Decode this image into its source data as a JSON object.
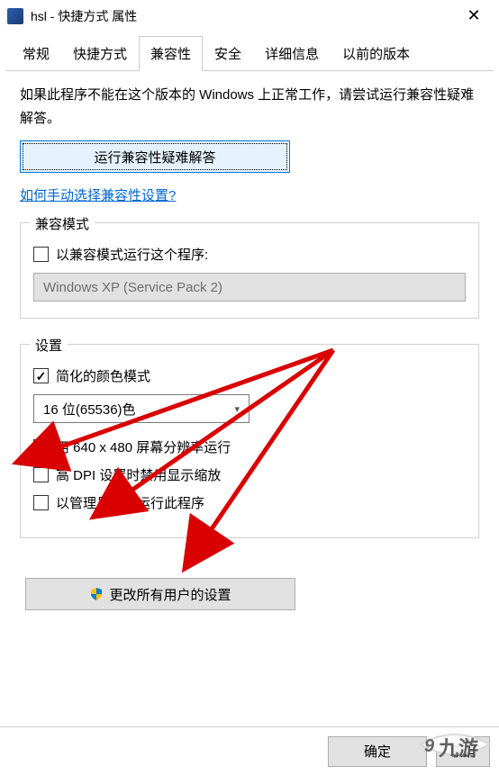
{
  "window": {
    "title": "hsl - 快捷方式 属性",
    "icon_label": "hsl"
  },
  "tabs": {
    "items": [
      {
        "label": "常规"
      },
      {
        "label": "快捷方式"
      },
      {
        "label": "兼容性"
      },
      {
        "label": "安全"
      },
      {
        "label": "详细信息"
      },
      {
        "label": "以前的版本"
      }
    ],
    "active_index": 2
  },
  "body": {
    "desc": "如果此程序不能在这个版本的 Windows 上正常工作，请尝试运行兼容性疑难解答。",
    "troubleshoot_btn": "运行兼容性疑难解答",
    "manual_link": "如何手动选择兼容性设置?"
  },
  "compat_mode": {
    "legend": "兼容模式",
    "checkbox_label": "以兼容模式运行这个程序:",
    "checked": false,
    "combo_value": "Windows XP (Service Pack 2)",
    "combo_enabled": false
  },
  "settings": {
    "legend": "设置",
    "reduced_color": {
      "label": "简化的颜色模式",
      "checked": true
    },
    "color_combo": {
      "value": "16 位(65536)色",
      "enabled": true
    },
    "res_640": {
      "label": "用 640 x 480 屏幕分辨率运行",
      "checked": false
    },
    "high_dpi": {
      "label": "高 DPI 设置时禁用显示缩放",
      "checked": false
    },
    "admin": {
      "label": "以管理员身份运行此程序",
      "checked": false
    }
  },
  "all_users_btn": "更改所有用户的设置",
  "buttons": {
    "ok": "确定",
    "cancel": "取消"
  },
  "watermark": "九游"
}
